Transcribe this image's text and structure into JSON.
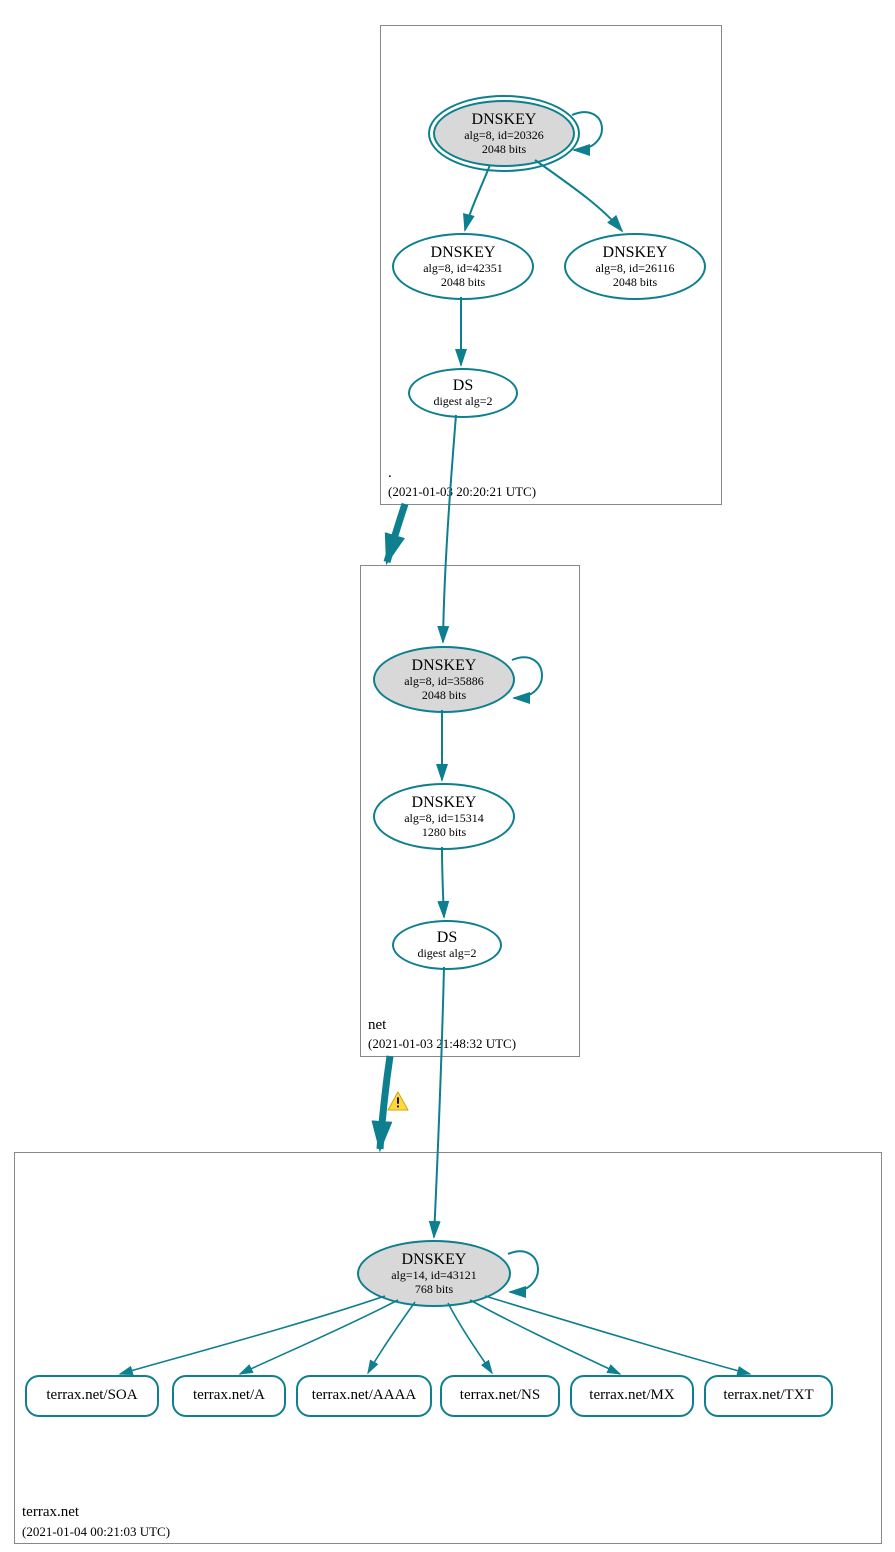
{
  "colors": {
    "stroke": "#0d7f8f",
    "fill": "#d8d8d8"
  },
  "zones": {
    "root": {
      "name": ".",
      "timestamp": "(2021-01-03 20:20:21 UTC)",
      "nodes": {
        "ksk": {
          "title": "DNSKEY",
          "line1": "alg=8, id=20326",
          "line2": "2048 bits"
        },
        "zsk1": {
          "title": "DNSKEY",
          "line1": "alg=8, id=42351",
          "line2": "2048 bits"
        },
        "zsk2": {
          "title": "DNSKEY",
          "line1": "alg=8, id=26116",
          "line2": "2048 bits"
        },
        "ds": {
          "title": "DS",
          "line1": "digest alg=2"
        }
      }
    },
    "net": {
      "name": "net",
      "timestamp": "(2021-01-03 21:48:32 UTC)",
      "nodes": {
        "ksk": {
          "title": "DNSKEY",
          "line1": "alg=8, id=35886",
          "line2": "2048 bits"
        },
        "zsk": {
          "title": "DNSKEY",
          "line1": "alg=8, id=15314",
          "line2": "1280 bits"
        },
        "ds": {
          "title": "DS",
          "line1": "digest alg=2"
        }
      }
    },
    "terrax": {
      "name": "terrax.net",
      "timestamp": "(2021-01-04 00:21:03 UTC)",
      "nodes": {
        "ksk": {
          "title": "DNSKEY",
          "line1": "alg=14, id=43121",
          "line2": "768 bits"
        }
      },
      "rrsets": {
        "soa": "terrax.net/SOA",
        "a": "terrax.net/A",
        "aaaa": "terrax.net/AAAA",
        "ns": "terrax.net/NS",
        "mx": "terrax.net/MX",
        "txt": "terrax.net/TXT"
      }
    }
  }
}
